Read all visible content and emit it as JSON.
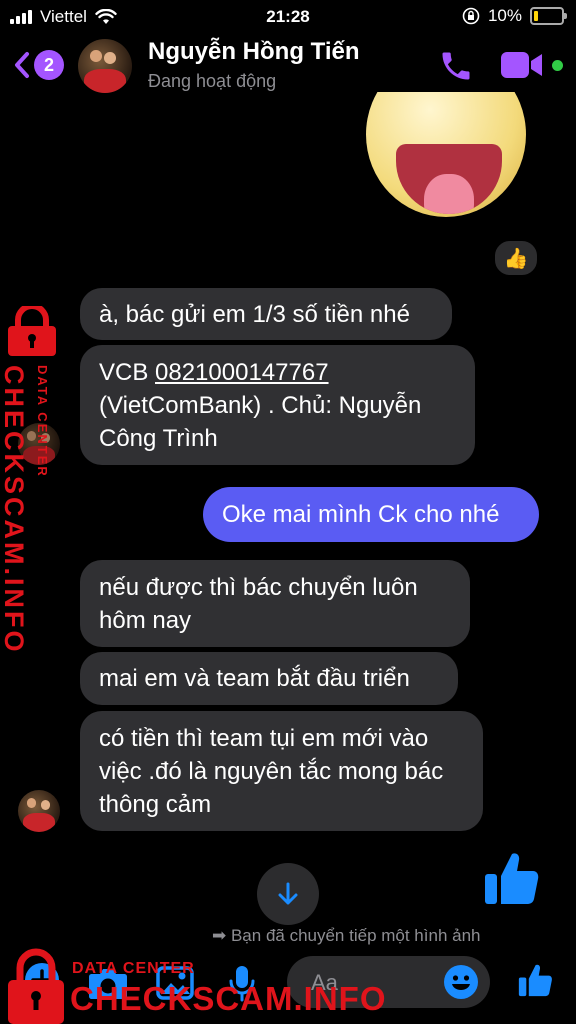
{
  "status_bar": {
    "carrier": "Viettel",
    "time": "21:28",
    "battery": "10%",
    "battery_color": "#ffd60a"
  },
  "header": {
    "back_badge": "2",
    "contact_name": "Nguyễn Hồng Tiến",
    "presence": "Đang hoạt động",
    "accent": "#a455ff",
    "online_color": "#31cc46"
  },
  "conversation": {
    "sticker": "laughing-tongue-sticker",
    "reaction": "👍",
    "messages": [
      {
        "from": "them",
        "text": "à, bác gửi em 1/3 số tiền nhé"
      },
      {
        "from": "them",
        "prefix": "VCB ",
        "account": "0821000147767",
        "text": "(VietComBank) . Chủ: Nguyễn Công Trình"
      },
      {
        "from": "me",
        "text": "Oke mai mình Ck cho nhé"
      },
      {
        "from": "them",
        "text": "nếu được thì bác chuyển luôn hôm nay"
      },
      {
        "from": "them",
        "text": "mai em và team bắt đầu triển"
      },
      {
        "from": "them",
        "text": "có tiền thì team tụi em mới vào việc .đó là nguyên tắc mong bác thông cảm"
      }
    ],
    "forward_note": "Bạn đã chuyển tiếp một hình ảnh",
    "outgoing_color": "#5a5cf3",
    "incoming_color": "#303033"
  },
  "composer": {
    "placeholder": "Aa"
  },
  "watermark": {
    "site": "CHECKSCAM.INFO",
    "tagline": "DATA CENTER",
    "color": "#e0141b"
  }
}
